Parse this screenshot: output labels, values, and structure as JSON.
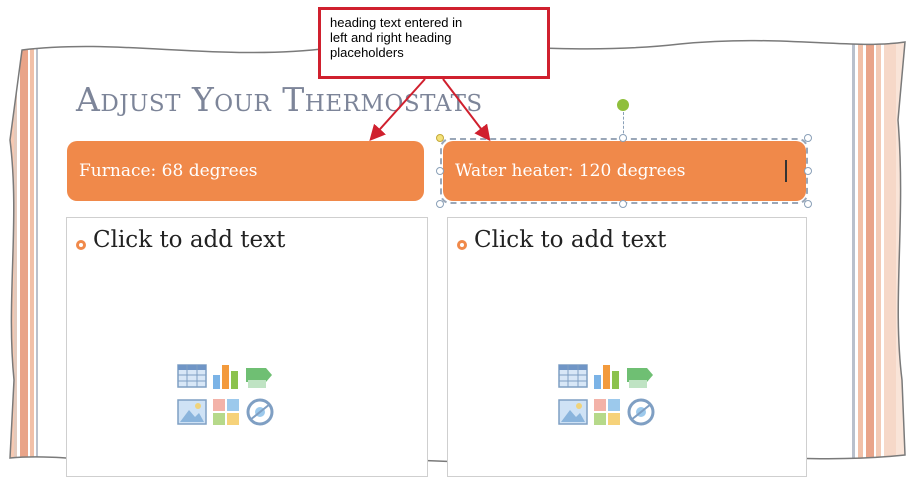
{
  "callout": {
    "lines": [
      "heading text entered in",
      "left and right heading",
      "placeholders"
    ]
  },
  "slide": {
    "title": "Adjust Your Thermostats",
    "left_heading": "Furnace: 68 degrees",
    "right_heading": "Water heater: 120 degrees",
    "left_placeholder": "Click to add text",
    "right_placeholder": "Click to add text"
  },
  "content_icons": [
    "insert-table-icon",
    "insert-chart-icon",
    "insert-smartart-icon",
    "insert-picture-icon",
    "clip-art-icon",
    "insert-media-icon"
  ],
  "colors": {
    "heading_fill": "#f0894a",
    "title_text": "#7d8599",
    "callout_border": "#d0202e",
    "rotate_handle": "#8fbf3c"
  }
}
